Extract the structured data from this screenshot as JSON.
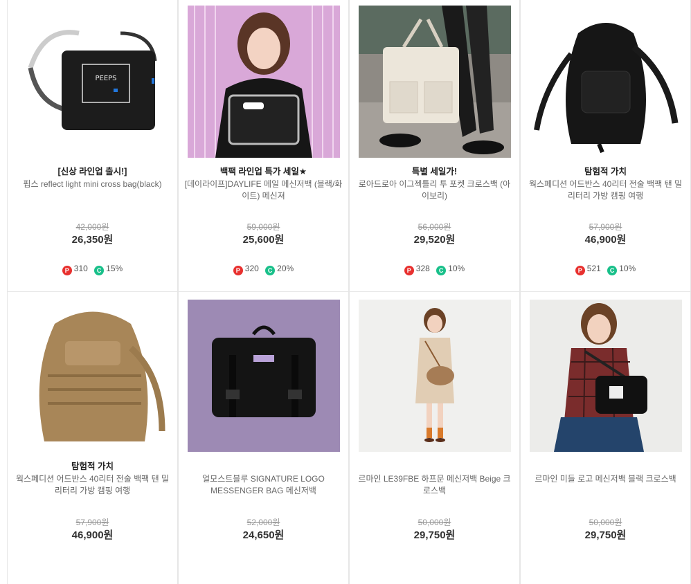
{
  "products": [
    {
      "tag": "[신상 라인업 출시!]",
      "name": "핍스 reflect light mini cross bag(black)",
      "orig_price": "42,000원",
      "sale_price": "26,350원",
      "point_badge": "P",
      "points": "310",
      "coupon_badge": "C",
      "coupon": "15%",
      "image": "black-mini-crossbag"
    },
    {
      "tag": "백팩 라인업 특가 세일★",
      "name": "[데이라이프]DAYLIFE 메일 메신저백 (블랙/화이트) 메신져",
      "orig_price": "59,000원",
      "sale_price": "25,600원",
      "point_badge": "P",
      "points": "320",
      "coupon_badge": "C",
      "coupon": "20%",
      "image": "model-with-messenger-bag"
    },
    {
      "tag": "특별 세일가!",
      "name": "로아드로아 이그젝틀리 투 포켓 크로스백 (아이보리)",
      "orig_price": "56,000원",
      "sale_price": "29,520원",
      "point_badge": "P",
      "points": "328",
      "coupon_badge": "C",
      "coupon": "10%",
      "image": "ivory-tote-bag"
    },
    {
      "tag": "탐험적 가치",
      "name": "웍스페디션 어드반스 40리터 전술 백팩 탠 밀리터리 가방 캠핑 여행",
      "orig_price": "57,900원",
      "sale_price": "46,900원",
      "point_badge": "P",
      "points": "521",
      "coupon_badge": "C",
      "coupon": "10%",
      "image": "black-tactical-backpack"
    },
    {
      "tag": "탐험적 가치",
      "name": "웍스페디션 어드반스 40리터 전술 백팩 탠 밀리터리 가방 캠핑 여행",
      "orig_price": "57,900원",
      "sale_price": "46,900원",
      "image": "tan-tactical-backpack"
    },
    {
      "tag": "",
      "name": "얼모스트블루 SIGNATURE LOGO MESSENGER BAG 메신저백",
      "orig_price": "52,000원",
      "sale_price": "24,650원",
      "image": "black-messenger-bag"
    },
    {
      "tag": "",
      "name": "르마인 LE39FBE 하프문 메신저백 Beige 크로스백",
      "orig_price": "50,000원",
      "sale_price": "29,750원",
      "image": "model-beige-halfmoon-bag"
    },
    {
      "tag": "",
      "name": "르마인 미들 로고 메신저백 블랙 크로스백",
      "orig_price": "50,000원",
      "sale_price": "29,750원",
      "image": "model-black-messenger-bag"
    }
  ]
}
